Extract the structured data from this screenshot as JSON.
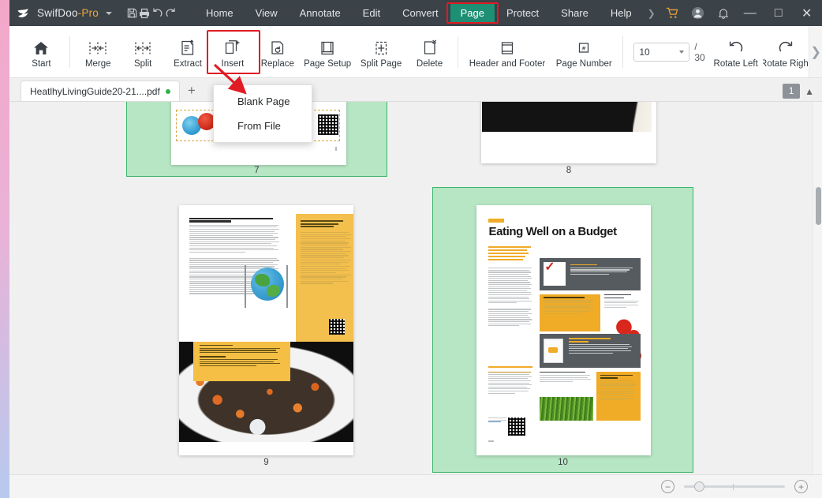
{
  "titlebar": {
    "brand_name": "SwifDoo",
    "brand_suffix": "-Pro",
    "logo_icon": "swift-bird-logo",
    "brand_caret_icon": "chevron-down-icon",
    "quick_actions": [
      {
        "name": "save-icon",
        "label": "Save"
      },
      {
        "name": "print-icon",
        "label": "Print"
      },
      {
        "name": "undo-icon",
        "label": "Undo"
      },
      {
        "name": "redo-icon",
        "label": "Redo"
      }
    ],
    "tabs": [
      {
        "label": "Home",
        "active": false
      },
      {
        "label": "View",
        "active": false
      },
      {
        "label": "Annotate",
        "active": false
      },
      {
        "label": "Edit",
        "active": false
      },
      {
        "label": "Convert",
        "active": false
      },
      {
        "label": "Page",
        "active": true
      },
      {
        "label": "Protect",
        "active": false
      },
      {
        "label": "Share",
        "active": false
      },
      {
        "label": "Help",
        "active": false
      }
    ],
    "overflow_icon": "chevron-right-icon",
    "right_icons": [
      {
        "name": "cart-icon",
        "label": "Store"
      },
      {
        "name": "account-icon",
        "label": "Account"
      },
      {
        "name": "bell-icon",
        "label": "Notifications"
      }
    ],
    "window_controls": [
      {
        "name": "minimize-button",
        "glyph": "—"
      },
      {
        "name": "maximize-button",
        "glyph": "□"
      },
      {
        "name": "close-button",
        "glyph": "✕"
      }
    ],
    "active_tab_highlight_color": "#1c8f74",
    "annotation_color": "#e01b24"
  },
  "ribbon": {
    "items": [
      {
        "label": "Start",
        "icon": "home-icon"
      },
      {
        "label": "Merge",
        "icon": "merge-icon"
      },
      {
        "label": "Split",
        "icon": "split-icon"
      },
      {
        "label": "Extract",
        "icon": "extract-icon"
      },
      {
        "label": "Insert",
        "icon": "insert-page-icon"
      },
      {
        "label": "Replace",
        "icon": "replace-page-icon"
      },
      {
        "label": "Page Setup",
        "icon": "page-setup-icon"
      },
      {
        "label": "Split Page",
        "icon": "split-page-icon"
      },
      {
        "label": "Delete",
        "icon": "delete-page-icon"
      },
      {
        "label": "Header and Footer",
        "icon": "header-footer-icon"
      },
      {
        "label": "Page Number",
        "icon": "page-number-icon"
      },
      {
        "label": "Rotate Left",
        "icon": "rotate-left-icon"
      },
      {
        "label": "Rotate Right",
        "icon": "rotate-right-icon"
      }
    ],
    "page_input_value": "10",
    "page_total": "/ 30",
    "overflow_icon": "chevron-right-icon"
  },
  "insert_menu": {
    "items": [
      {
        "label": "Blank Page",
        "name": "menu-item-blank-page"
      },
      {
        "label": "From File",
        "name": "menu-item-from-file"
      }
    ],
    "pointer_annotation": "red-arrow-to-blank-page"
  },
  "tabstrip": {
    "document_name": "HeatlhyLivingGuide20-21....pdf",
    "modified_dot": true,
    "new_tab_glyph": "+",
    "page_badge": "1",
    "collapse_icon": "chevron-up-icon"
  },
  "thumbnails": [
    {
      "number": "7",
      "selected": true,
      "kind": "recipe-page-bottom",
      "alt": "Partial page with food icons and QR code"
    },
    {
      "number": "8",
      "selected": false,
      "kind": "dark-recipe-page-bottom",
      "alt": "Partial dark recipe page with ingredient list, SERVES 4"
    },
    {
      "number": "9",
      "selected": false,
      "kind": "health-planet-page",
      "heading": "FOR YOUR HEALTH AND THE PLANET'S HEALTH",
      "sidebar_heading": "Can plant-based meat alternatives be part of a healthy and sustainable diet?",
      "callout_heading": "TYPES OF LENTILS",
      "callout_heading2": "COOKING TIPS",
      "alt": "Article page with globe illustration, yellow sidebar, QR code and lentil salad photo"
    },
    {
      "number": "10",
      "selected": true,
      "kind": "eating-well-budget-page",
      "title": "Eating Well on a Budget",
      "subtitle": "From the supermarket to the kitchen, here are some strategies to get the biggest nutrition bang for your buck.",
      "tips": [
        "Shop your pantry first",
        "Don't shop on an empty stomach",
        "Consider meatless meals",
        "Purchase foods and snacks that are satiating and filling",
        "Scan the discounted produce cart",
        "Shop with a list, but allow for flexibility"
      ],
      "note_heading": "A NOTE ON FOOD AFFORDABILITY",
      "alt": "Magazine page titled Eating Well on a Budget with gray and yellow tip boxes, chip bag illustration, asparagus photo and QR code"
    }
  ],
  "statusbar": {
    "zoom_out_glyph": "−",
    "zoom_in_glyph": "+",
    "zoom_out_name": "zoom-out-button",
    "zoom_in_name": "zoom-in-button"
  },
  "colors": {
    "titlebar": "#3b4248",
    "accent_green": "#1c8f74",
    "selection_green_fill": "#b6e6c3",
    "selection_green_border": "#3bb56a",
    "annotation_red": "#e01b24",
    "brand_orange": "#f0a93a"
  }
}
